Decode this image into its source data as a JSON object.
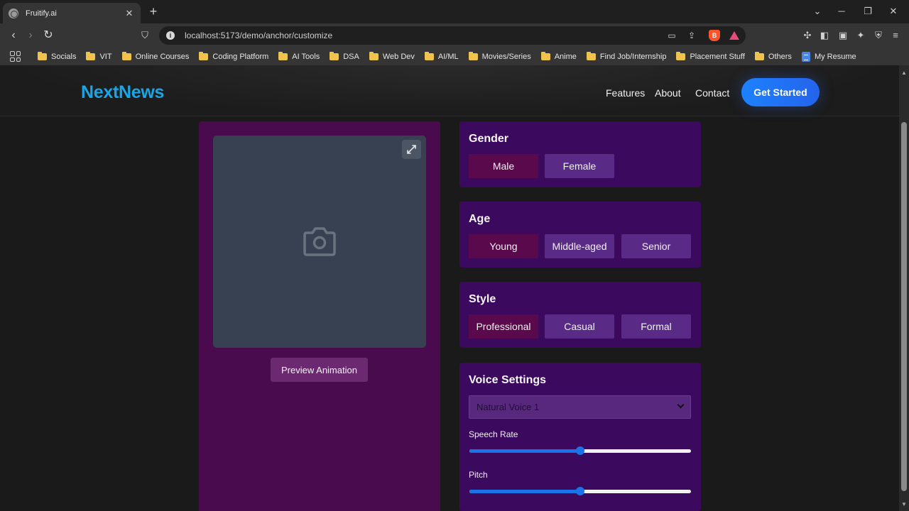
{
  "browser": {
    "tab_title": "Fruitify.ai",
    "tab_close": "✕",
    "new_tab": "+",
    "url": "localhost:5173/demo/anchor/customize",
    "bookmarks": [
      "Socials",
      "VIT",
      "Online Courses",
      "Coding Platform",
      "AI Tools",
      "DSA",
      "Web Dev",
      "AI/ML",
      "Movies/Series",
      "Anime",
      "Find Job/Internship",
      "Placement Stuff",
      "Others",
      "My Resume"
    ]
  },
  "header": {
    "logo": "NextNews",
    "nav": [
      "Features",
      "About",
      "Contact"
    ],
    "cta": "Get Started"
  },
  "preview": {
    "button": "Preview Animation"
  },
  "gender": {
    "title": "Gender",
    "options": [
      "Male",
      "Female"
    ],
    "selected": "Male"
  },
  "age": {
    "title": "Age",
    "options": [
      "Young",
      "Middle-aged",
      "Senior"
    ],
    "selected": "Young"
  },
  "style": {
    "title": "Style",
    "options": [
      "Professional",
      "Casual",
      "Formal"
    ],
    "selected": "Professional"
  },
  "voice": {
    "title": "Voice Settings",
    "selected_voice": "Natural Voice 1",
    "speech_rate_label": "Speech Rate",
    "speech_rate_value": 0.5,
    "pitch_label": "Pitch",
    "pitch_value": 0.5
  },
  "colors": {
    "accent": "#1a73e8",
    "logo": "#1aa6e6",
    "preview_panel": "#4a0a4e",
    "card": "#3b0a5e",
    "option_selected": "#5a0a4c",
    "option": "#5a2b86"
  }
}
